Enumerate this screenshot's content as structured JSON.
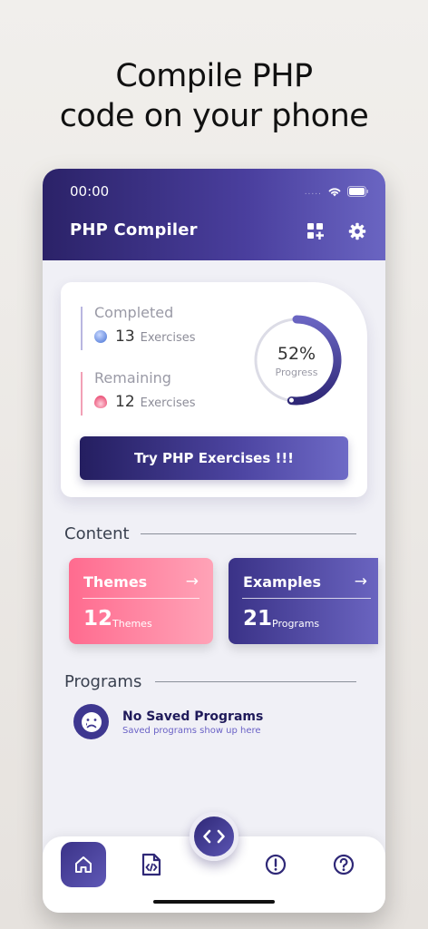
{
  "headline": {
    "line1": "Compile PHP",
    "line2": "code on your phone"
  },
  "status_bar": {
    "time": "00:00",
    "signal": "....."
  },
  "app_bar": {
    "title": "PHP Compiler"
  },
  "progress_card": {
    "completed": {
      "label": "Completed",
      "count": "13",
      "unit": "Exercises"
    },
    "remaining": {
      "label": "Remaining",
      "count": "12",
      "unit": "Exercises"
    },
    "progress_percent_text": "52%",
    "progress_value": 0.52,
    "progress_label": "Progress",
    "cta_label": "Try PHP Exercises !!!"
  },
  "content_section": {
    "title": "Content",
    "tiles": [
      {
        "title": "Themes",
        "arrow": "→",
        "count": "12",
        "unit": "Themes"
      },
      {
        "title": "Examples",
        "arrow": "→",
        "count": "21",
        "unit": "Programs"
      }
    ]
  },
  "programs_section": {
    "title": "Programs",
    "empty_title": "No Saved Programs",
    "empty_subtitle": "Saved programs show up here"
  },
  "bottom_nav": {
    "items": [
      "home-icon",
      "file-code-icon",
      "code-icon",
      "alert-icon",
      "help-icon"
    ],
    "active": "home-icon"
  },
  "colors": {
    "primary": "#3b3388",
    "accent_light": "#6a65c2",
    "pink": "#ff6b8f",
    "ring_track": "#dcdce6"
  }
}
